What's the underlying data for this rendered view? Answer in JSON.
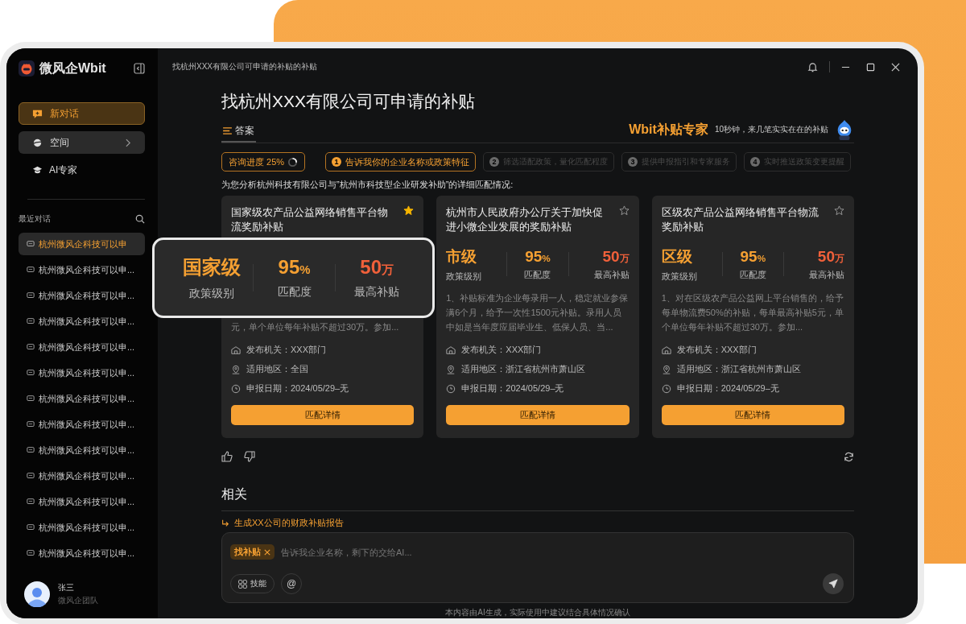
{
  "app": {
    "name": "微风企Wbit"
  },
  "sidebar": {
    "nav": [
      {
        "label": "新对话",
        "kind": "new",
        "selected": true
      },
      {
        "label": "空间",
        "kind": "space",
        "selected": false
      },
      {
        "label": "AI专家",
        "kind": "expert",
        "selected": false
      }
    ],
    "recent_title": "最近对话",
    "history": [
      {
        "label": "杭州微风企科技可以申",
        "selected": true
      },
      {
        "label": "杭州微风企科技可以申...",
        "selected": false
      },
      {
        "label": "杭州微风企科技可以申...",
        "selected": false
      },
      {
        "label": "杭州微风企科技可以申...",
        "selected": false
      },
      {
        "label": "杭州微风企科技可以申...",
        "selected": false
      },
      {
        "label": "杭州微风企科技可以申...",
        "selected": false
      },
      {
        "label": "杭州微风企科技可以申...",
        "selected": false
      },
      {
        "label": "杭州微风企科技可以申...",
        "selected": false
      },
      {
        "label": "杭州微风企科技可以申...",
        "selected": false
      },
      {
        "label": "杭州微风企科技可以申...",
        "selected": false
      },
      {
        "label": "杭州微风企科技可以申...",
        "selected": false
      },
      {
        "label": "杭州微风企科技可以申...",
        "selected": false
      },
      {
        "label": "杭州微风企科技可以申...",
        "selected": false
      }
    ],
    "user": {
      "name": "张三",
      "team": "微风企团队"
    }
  },
  "title_bar": {
    "breadcrumb": "找杭州XXX有限公司可申请的补贴的补贴"
  },
  "question": "找杭州XXX有限公司可申请的补贴",
  "answer_tab": "答案",
  "expert": {
    "name": "Wbit补贴专家",
    "tagline": "10秒钟，来几笔实实在在的补贴"
  },
  "progress": {
    "label": "咨询进度 25%",
    "level": 0.25
  },
  "steps": [
    {
      "number": "1",
      "label": "告诉我你的企业名称或政策特征",
      "active": true
    },
    {
      "number": "2",
      "label": "筛选适配政策，量化匹配程度",
      "active": false
    },
    {
      "number": "3",
      "label": "提供申报指引和专家服务",
      "active": false
    },
    {
      "number": "4",
      "label": "实时推送政策变更提醒",
      "active": false
    }
  ],
  "intro": "为您分析杭州科技有限公司与”杭州市科技型企业研发补助”的详细匹配情况:",
  "cards": [
    {
      "title": "国家级农产品公益网络销售平台物流奖励补贴",
      "starred": true,
      "description": "元，单个单位每年补贴不超过30万。参加...",
      "details": [
        {
          "kind": "issuer",
          "text": "发布机关：XXX部门"
        },
        {
          "kind": "region",
          "text": "适用地区：全国"
        },
        {
          "kind": "date",
          "text": "申报日期：2024/05/29–无"
        }
      ],
      "button": "匹配详情"
    },
    {
      "title": "杭州市人民政府办公厅关于加快促进小微企业发展的奖励补贴",
      "starred": false,
      "stats": [
        {
          "kind": "level",
          "value": "市级",
          "label": "政策级别"
        },
        {
          "kind": "match",
          "value": "95",
          "unit": "%",
          "label": "匹配度"
        },
        {
          "kind": "amount",
          "value": "50",
          "unit": "万",
          "label": "最高补贴"
        }
      ],
      "description": "1、补贴标准为企业每录用一人，稳定就业参保满6个月，给予一次性1500元补贴。录用人员中如是当年度应届毕业生、低保人员、当...",
      "details": [
        {
          "kind": "issuer",
          "text": "发布机关：XXX部门"
        },
        {
          "kind": "region",
          "text": "适用地区：浙江省杭州市萧山区"
        },
        {
          "kind": "date",
          "text": "申报日期：2024/05/29–无"
        }
      ],
      "button": "匹配详情"
    },
    {
      "title": "区级农产品公益网络销售平台物流奖励补贴",
      "starred": false,
      "stats": [
        {
          "kind": "level",
          "value": "区级",
          "label": "政策级别"
        },
        {
          "kind": "match",
          "value": "95",
          "unit": "%",
          "label": "匹配度"
        },
        {
          "kind": "amount",
          "value": "50",
          "unit": "万",
          "label": "最高补贴"
        }
      ],
      "description": "1、对在区级农产品公益网上平台销售的，给予每单物流费50%的补贴，每单最高补贴5元，单个单位每年补贴不超过30万。参加...",
      "details": [
        {
          "kind": "issuer",
          "text": "发布机关：XXX部门"
        },
        {
          "kind": "region",
          "text": "适用地区：浙江省杭州市萧山区"
        },
        {
          "kind": "date",
          "text": "申报日期：2024/05/29–无"
        }
      ],
      "button": "匹配详情"
    }
  ],
  "callout": {
    "stats": [
      {
        "kind": "level",
        "value": "国家级",
        "label": "政策级别"
      },
      {
        "kind": "match",
        "value": "95",
        "unit": "%",
        "label": "匹配度"
      },
      {
        "kind": "amount",
        "value": "50",
        "unit": "万",
        "label": "最高补贴"
      }
    ]
  },
  "related": {
    "title": "相关",
    "items": [
      "生成XX公司的财政补贴报告"
    ]
  },
  "composer": {
    "tag": "找补贴",
    "placeholder": "告诉我企业名称，剩下的交给AI...",
    "skill_button": "技能",
    "mention": "@"
  },
  "footer": "本内容由AI生成，实际使用中建议结合具体情况确认"
}
